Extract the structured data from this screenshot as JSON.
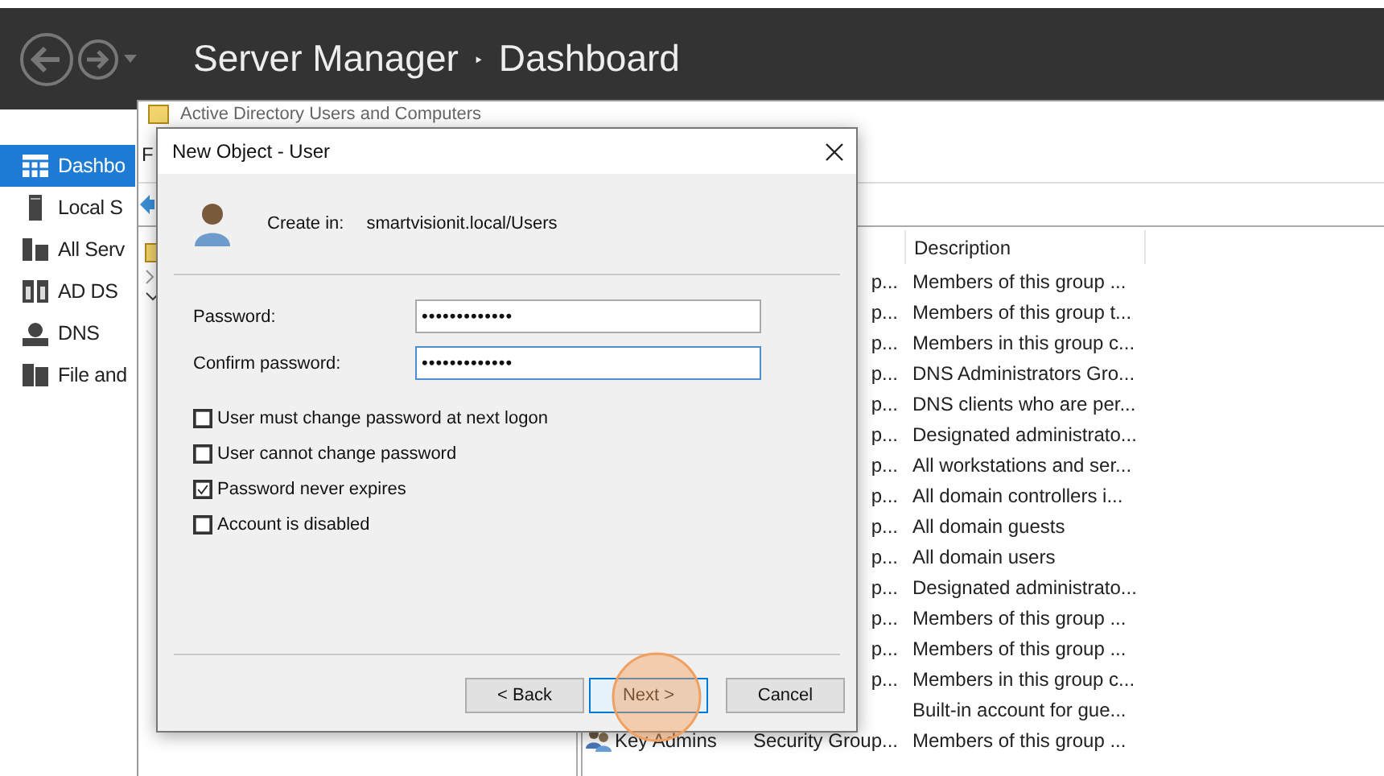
{
  "server_manager": {
    "title": "Server Manager",
    "separator": "‣",
    "page": "Dashboard"
  },
  "sidebar": {
    "items": [
      {
        "label": "Dashbo",
        "selected": true
      },
      {
        "label": "Local S",
        "selected": false
      },
      {
        "label": "All Serv",
        "selected": false
      },
      {
        "label": "AD DS",
        "selected": false
      },
      {
        "label": "DNS",
        "selected": false
      },
      {
        "label": "File and",
        "selected": false
      }
    ]
  },
  "aduc_window": {
    "title": "Active Directory Users and Computers",
    "menu": [
      "F"
    ],
    "table": {
      "columns": [
        "Description"
      ],
      "rows": [
        {
          "type": "p...",
          "description": "Members of this group ..."
        },
        {
          "type": "p...",
          "description": "Members of this group t..."
        },
        {
          "type": "p...",
          "description": "Members in this group c..."
        },
        {
          "type": "p...",
          "description": "DNS Administrators Gro..."
        },
        {
          "type": "p...",
          "description": "DNS clients who are per..."
        },
        {
          "type": "p...",
          "description": "Designated administrato..."
        },
        {
          "type": "p...",
          "description": "All workstations and ser..."
        },
        {
          "type": "p...",
          "description": "All domain controllers i..."
        },
        {
          "type": "p...",
          "description": "All domain guests"
        },
        {
          "type": "p...",
          "description": "All domain users"
        },
        {
          "type": "p...",
          "description": "Designated administrato..."
        },
        {
          "type": "p...",
          "description": "Members of this group ..."
        },
        {
          "type": "p...",
          "description": "Members of this group ..."
        },
        {
          "type": "p...",
          "description": "Members in this group c..."
        },
        {
          "description": "Built-in account for gue..."
        },
        {
          "name": "Key Admins",
          "type": "Security Group...",
          "description": "Members of this group ..."
        }
      ]
    }
  },
  "dialog": {
    "title": "New Object - User",
    "create_in_label": "Create in:",
    "create_in_path": "smartvisionit.local/Users",
    "fields": [
      {
        "label": "Password:",
        "value": "•••••••••••••",
        "focused": false
      },
      {
        "label": "Confirm password:",
        "value": "•••••••••••••",
        "focused": true
      }
    ],
    "options": [
      {
        "label": "User must change password at next logon",
        "checked": false
      },
      {
        "label": "User cannot change password",
        "checked": false
      },
      {
        "label": "Password never expires",
        "checked": true
      },
      {
        "label": "Account is disabled",
        "checked": false
      }
    ],
    "buttons": [
      {
        "label": "< Back",
        "focused": false
      },
      {
        "label": "Next >",
        "focused": true
      },
      {
        "label": "Cancel",
        "focused": false
      }
    ]
  }
}
